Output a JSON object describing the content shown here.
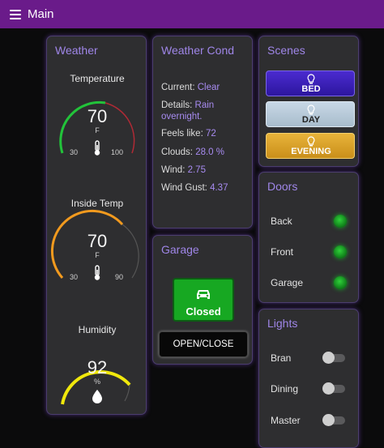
{
  "topbar": {
    "title": "Main"
  },
  "weather": {
    "title": "Weather",
    "temperature": {
      "label": "Temperature",
      "value": "70",
      "unit": "F",
      "min": "30",
      "max": "100",
      "level": 0.57
    },
    "inside_temp": {
      "label": "Inside Temp",
      "value": "70",
      "unit": "F",
      "min": "30",
      "max": "90",
      "level": 0.67
    },
    "humidity": {
      "label": "Humidity",
      "value": "92",
      "unit": "%",
      "level": 0.92
    }
  },
  "conditions": {
    "title": "Weather Cond",
    "rows": [
      {
        "label": "Current: ",
        "value": "Clear"
      },
      {
        "label": "Details: ",
        "value": "Rain overnight."
      },
      {
        "label": "Feels like: ",
        "value": "72"
      },
      {
        "label": "Clouds: ",
        "value": "28.0 %"
      },
      {
        "label": "Wind: ",
        "value": "2.75"
      },
      {
        "label": "Wind Gust: ",
        "value": "4.37"
      }
    ]
  },
  "garage": {
    "title": "Garage",
    "status": "Closed",
    "button": "OPEN/CLOSE"
  },
  "scenes": {
    "title": "Scenes",
    "buttons": [
      {
        "label": "BED"
      },
      {
        "label": "DAY"
      },
      {
        "label": "EVENING"
      }
    ]
  },
  "doors": {
    "title": "Doors",
    "items": [
      {
        "label": "Back",
        "status": "closed"
      },
      {
        "label": "Front",
        "status": "closed"
      },
      {
        "label": "Garage",
        "status": "closed"
      }
    ]
  },
  "lights": {
    "title": "Lights",
    "items": [
      {
        "label": "Bran",
        "on": false
      },
      {
        "label": "Dining",
        "on": false
      },
      {
        "label": "Master",
        "on": false
      }
    ]
  },
  "colors": {
    "accent": "#9f86e8",
    "topbar": "#6a1b8a",
    "green": "#17a822",
    "bed": "#3a1fb8",
    "day": "#b9cbdc",
    "evening": "#d9a32b",
    "gauge_orange": "#f29a1e",
    "gauge_yellow": "#f0e80c",
    "gauge_green": "#22c33a",
    "gauge_red": "#b02a35"
  }
}
